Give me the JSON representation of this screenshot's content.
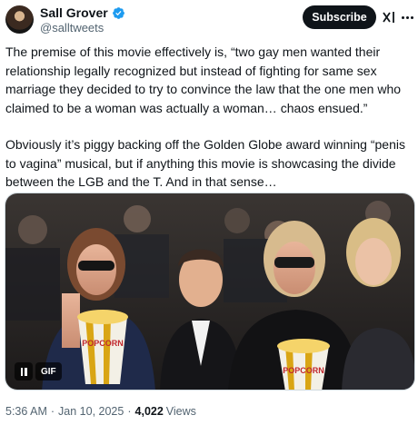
{
  "author": {
    "display_name": "Sall Grover",
    "handle": "@salltweets",
    "verified": true,
    "verified_color": "#1d9bf0"
  },
  "actions": {
    "subscribe_label": "Subscribe",
    "grok_icon": "grok-icon",
    "more_icon": "more-icon"
  },
  "tweet": {
    "paragraphs": [
      "The premise of this movie effectively is, “two gay men wanted their relationship legally recognized but instead of fighting for same sex marriage they decided to try to convince the law that the one men who claimed to be a woman was actually a woman… chaos ensued.”",
      "Obviously it’s piggy backing off the Golden Globe award winning “penis to vagina” musical, but if anything this movie is showcasing the divide between the LGB and the T. And in that sense…"
    ]
  },
  "media": {
    "type": "gif",
    "badge_label": "GIF",
    "popcorn_text": "POPCORN"
  },
  "meta": {
    "time": "5:36 AM",
    "separator": "·",
    "date": "Jan 10, 2025",
    "views_count": "4,022",
    "views_label": "Views"
  }
}
